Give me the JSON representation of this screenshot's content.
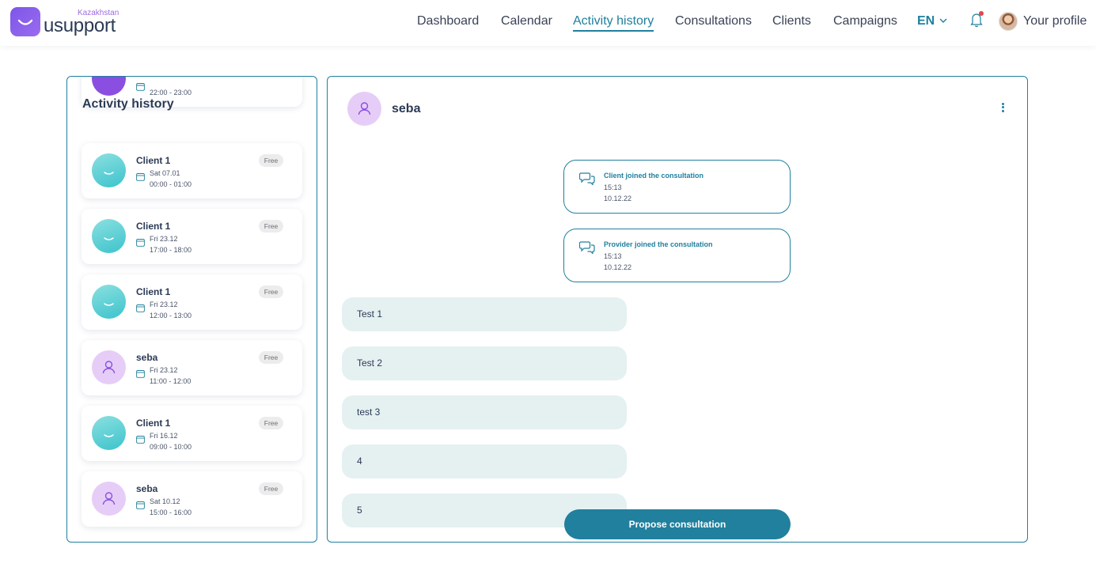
{
  "brand": {
    "country": "Kazakhstan",
    "name": "usupport"
  },
  "nav": {
    "items": [
      "Dashboard",
      "Calendar",
      "Activity history",
      "Consultations",
      "Clients",
      "Campaigns"
    ],
    "active": "Activity history",
    "language": "EN",
    "profile_label": "Your profile",
    "icons": [
      "chevron-down-icon",
      "bell-icon"
    ],
    "notification_dot_color": "#e0474c"
  },
  "activity": {
    "title": "Activity history",
    "partial_card_time": "22:00 - 23:00",
    "items": [
      {
        "name": "Client 1",
        "date": "Sat 07.01",
        "time": "00:00 - 01:00",
        "badge": "Free"
      },
      {
        "name": "Client 1",
        "date": "Fri 23.12",
        "time": "17:00 - 18:00",
        "badge": "Free"
      },
      {
        "name": "Client 1",
        "date": "Fri 23.12",
        "time": "12:00 - 13:00",
        "badge": "Free"
      },
      {
        "name": "seba",
        "date": "Fri 23.12",
        "time": "11:00 - 12:00",
        "badge": "Free"
      },
      {
        "name": "Client 1",
        "date": "Fri 16.12",
        "time": "09:00 - 10:00",
        "badge": "Free"
      },
      {
        "name": "seba",
        "date": "Sat 10.12",
        "time": "15:00 - 16:00",
        "badge": "Free"
      }
    ]
  },
  "chat": {
    "name": "seba",
    "system_messages": [
      {
        "title": "Client joined the consultation",
        "time": "15:13",
        "date": "10.12.22"
      },
      {
        "title": "Provider joined the consultation",
        "time": "15:13",
        "date": "10.12.22"
      }
    ],
    "messages": [
      "Test 1",
      "Test 2",
      "test 3",
      "4",
      "5"
    ],
    "propose_label": "Propose consultation"
  },
  "colors": {
    "accent": "#20809e",
    "brand_purple": "#8a4fe0",
    "bubble": "#e5f0f1"
  }
}
